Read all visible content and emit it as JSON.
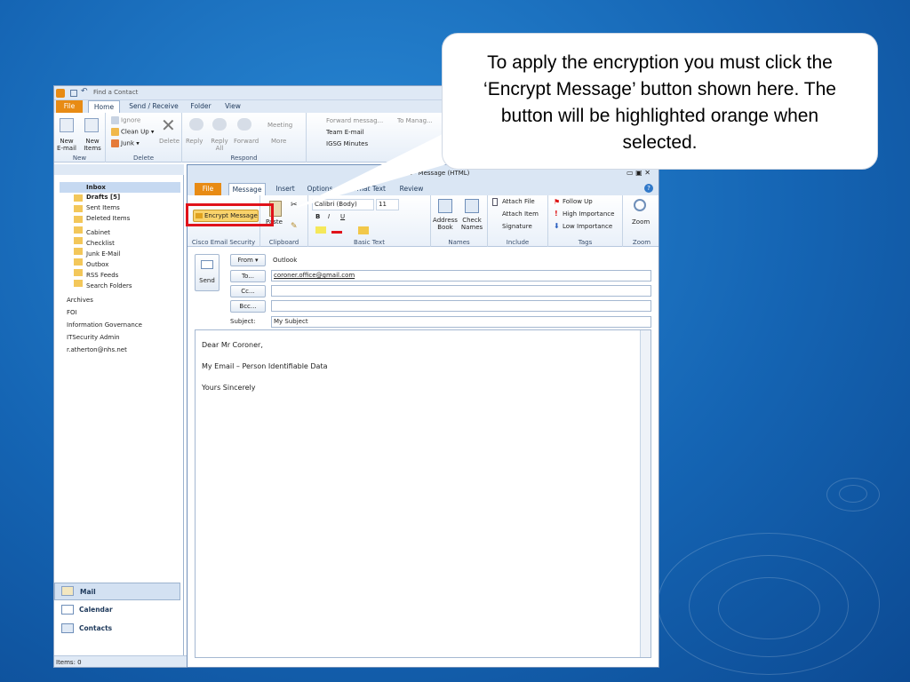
{
  "outlook": {
    "quick_access": "Find a Contact",
    "tabs": [
      "File",
      "Home",
      "Send / Receive",
      "Folder",
      "View"
    ],
    "ribbon": {
      "new_email": "New E-mail",
      "new_items": "New Items",
      "new_group": "New",
      "ignore": "Ignore",
      "clean_up": "Clean Up",
      "junk": "Junk",
      "delete": "Delete",
      "delete_group": "Delete",
      "reply": "Reply",
      "reply_all": "Reply All",
      "forward": "Forward",
      "meeting": "Meeting",
      "more": "More",
      "respond_group": "Respond",
      "quick_steps": [
        "Forward messag...",
        "To Manag...",
        "Team E-mail",
        "IGSG Minutes"
      ]
    },
    "folders": [
      "Inbox",
      "Drafts [5]",
      "Sent Items",
      "Deleted Items",
      "Cabinet",
      "Checklist",
      "Junk E-Mail",
      "Outbox",
      "RSS Feeds",
      "Search Folders"
    ],
    "accounts": [
      "Archives",
      "FOI",
      "Information Governance",
      "ITSecurity Admin",
      "r.atherton@nhs.net"
    ],
    "nav_buttons": [
      "Mail",
      "Calendar",
      "Contacts"
    ],
    "status": "Items: 0"
  },
  "message": {
    "title": "My Subject - Message (HTML)",
    "tabs": [
      "File",
      "Message",
      "Insert",
      "Options",
      "Format Text",
      "Review"
    ],
    "ribbon": {
      "encrypt": "Encrypt Message",
      "cisco_group": "Cisco Email Security",
      "paste": "Paste",
      "clipboard_group": "Clipboard",
      "font": "Calibri (Body)",
      "size": "11",
      "basic_text_group": "Basic Text",
      "address_book": "Address Book",
      "check_names": "Check Names",
      "names_group": "Names",
      "attach_file": "Attach File",
      "attach_item": "Attach Item",
      "signature": "Signature",
      "include_group": "Include",
      "follow_up": "Follow Up",
      "high_importance": "High Importance",
      "low_importance": "Low Importance",
      "tags_group": "Tags",
      "zoom": "Zoom",
      "zoom_group": "Zoom"
    },
    "send": "Send",
    "from_label": "From",
    "from_value": "Outlook",
    "to_label": "To...",
    "to_value": "coroner.office@gmail.com",
    "cc_label": "Cc...",
    "bcc_label": "Bcc...",
    "subject_label": "Subject:",
    "subject_value": "My Subject",
    "body": [
      "Dear Mr Coroner,",
      "My Email – Person Identifiable Data",
      "Yours Sincerely"
    ]
  },
  "callout": "To apply the encryption you must click the ‘Encrypt Message’ button shown here. The button will be highlighted orange when selected.",
  "colors": {
    "highlight": "#e0121a",
    "file_tab": "#e88b14",
    "encrypt_button": "#f9d36b"
  }
}
